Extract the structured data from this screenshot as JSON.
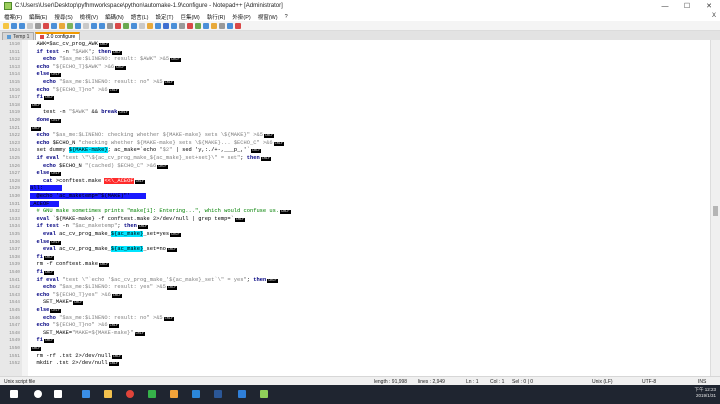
{
  "window": {
    "title": "C:\\Users\\User\\Desktop\\pyfhmworkspace\\python\\automake-1.9\\configure - Notepad++ [Administrator]",
    "controls": {
      "minimize": "—",
      "maximize": "☐",
      "close": "✕"
    }
  },
  "menu": {
    "items": [
      "檔案(F)",
      "編輯(E)",
      "搜尋(S)",
      "檢視(V)",
      "編碼(N)",
      "語言(L)",
      "設定(T)",
      "巨集(M)",
      "執行(R)",
      "外掛(P)",
      "視窗(W)",
      "?"
    ],
    "close": "X"
  },
  "tabs": [
    {
      "label": "Temp 1",
      "active": false
    },
    {
      "label": "2.0 configure",
      "active": true
    }
  ],
  "editor": {
    "lines": [
      {
        "num": "1510",
        "segs": [
          [
            "t",
            "  AWK=$ac_cv_prog_AWK"
          ],
          [
            "eol",
            "CRLF"
          ]
        ]
      },
      {
        "num": "1511",
        "segs": [
          [
            "k",
            "  if test "
          ],
          [
            "t",
            "-n "
          ],
          [
            "s",
            "\"$AWK\""
          ],
          [
            "t",
            "; "
          ],
          [
            "k",
            "then"
          ],
          [
            "eol",
            "CRLF"
          ]
        ]
      },
      {
        "num": "1512",
        "segs": [
          [
            "t",
            "    "
          ],
          [
            "k",
            "echo "
          ],
          [
            "s",
            "\"$as_me:$LINENO: result: $AWK\" >&5"
          ],
          [
            "eol",
            "CRLF"
          ]
        ]
      },
      {
        "num": "1513",
        "segs": [
          [
            "k",
            "  echo "
          ],
          [
            "s",
            "\"${ECHO_T}$AWK\" >&6"
          ],
          [
            "eol",
            "CRLF"
          ]
        ]
      },
      {
        "num": "1514",
        "segs": [
          [
            "k",
            "  else"
          ],
          [
            "eol",
            "CRLF"
          ]
        ]
      },
      {
        "num": "1515",
        "segs": [
          [
            "t",
            "    "
          ],
          [
            "k",
            "echo "
          ],
          [
            "s",
            "\"$as_me:$LINENO: result: no\" >&5"
          ],
          [
            "eol",
            "CRLF"
          ]
        ]
      },
      {
        "num": "1516",
        "segs": [
          [
            "k",
            "  echo "
          ],
          [
            "s",
            "\"${ECHO_T}no\" >&6"
          ],
          [
            "eol",
            "CRLF"
          ]
        ]
      },
      {
        "num": "1517",
        "segs": [
          [
            "k",
            "  fi"
          ],
          [
            "eol",
            "CRLF"
          ]
        ]
      },
      {
        "num": "1518",
        "segs": [
          [
            "eol",
            "CRLF"
          ]
        ]
      },
      {
        "num": "1519",
        "segs": [
          [
            "t",
            "    test -n "
          ],
          [
            "s",
            "\"$AWK\""
          ],
          [
            "t",
            " && "
          ],
          [
            "k",
            "break"
          ],
          [
            "eol",
            "CRLF"
          ]
        ]
      },
      {
        "num": "1520",
        "segs": [
          [
            "k",
            "  done"
          ],
          [
            "eol",
            "CRLF"
          ]
        ]
      },
      {
        "num": "1521",
        "segs": [
          [
            "eol",
            "CRLF"
          ]
        ]
      },
      {
        "num": "1522",
        "segs": [
          [
            "k",
            "  echo "
          ],
          [
            "s",
            "\"$as_me:$LINENO: checking whether ${MAKE-make} sets \\${MAKE}\" >&5"
          ],
          [
            "eol",
            "CRLF"
          ]
        ]
      },
      {
        "num": "1523",
        "segs": [
          [
            "k",
            "  echo "
          ],
          [
            "t",
            "$ECHO_N "
          ],
          [
            "s",
            "\"checking whether ${MAKE-make} sets \\${MAKE}... $ECHO_C\" >&6"
          ],
          [
            "eol",
            "CRLF"
          ]
        ]
      },
      {
        "num": "1524",
        "segs": [
          [
            "t",
            "  set dummy "
          ],
          [
            "cy",
            "${MAKE-make}"
          ],
          [
            "t",
            "; ac_make=`echo "
          ],
          [
            "s",
            "\"$2\""
          ],
          [
            "t",
            " | sed 'y,:./+-,___p_,'`"
          ],
          [
            "eol",
            "CRLF"
          ]
        ]
      },
      {
        "num": "1525",
        "segs": [
          [
            "k",
            "  if eval "
          ],
          [
            "s",
            "\"test \\\"\\${ac_cv_prog_make_${ac_make}_set+set}\\\" = set\""
          ],
          [
            "t",
            "; "
          ],
          [
            "k",
            "then"
          ],
          [
            "eol",
            "CRLF"
          ]
        ]
      },
      {
        "num": "1526",
        "segs": [
          [
            "t",
            "    "
          ],
          [
            "k",
            "echo "
          ],
          [
            "t",
            "$ECHO_N "
          ],
          [
            "s",
            "\"(cached) $ECHO_C\" >&6"
          ],
          [
            "eol",
            "CRLF"
          ]
        ]
      },
      {
        "num": "1527",
        "segs": [
          [
            "k",
            "  else"
          ],
          [
            "eol",
            "CRLF"
          ]
        ]
      },
      {
        "num": "1528",
        "segs": [
          [
            "t",
            "    "
          ],
          [
            "k",
            "cat "
          ],
          [
            "t",
            ">conftest.make "
          ],
          [
            "rd",
            "<<\\_ACEOF"
          ],
          [
            "eol",
            "CRLF"
          ]
        ]
      },
      {
        "num": "1529",
        "segs": [
          [
            "sel",
            "all:      "
          ]
        ]
      },
      {
        "num": "1530",
        "segs": [
          [
            "sel",
            "  @echo 'ac_maketemp=\"$(MAKE)\"'     "
          ]
        ]
      },
      {
        "num": "1531",
        "segs": [
          [
            "sel",
            "_ACEOF   "
          ]
        ]
      },
      {
        "num": "1532",
        "segs": [
          [
            "c",
            "  # GNU make sometimes prints \"make[1]: Entering...\", which would confuse us."
          ],
          [
            "eol",
            "CRLF"
          ]
        ]
      },
      {
        "num": "1533",
        "segs": [
          [
            "k",
            "  eval "
          ],
          [
            "t",
            "`${MAKE-make} -f conftest.make 2>/dev/null | grep temp=`"
          ],
          [
            "eol",
            "CRLF"
          ]
        ]
      },
      {
        "num": "1534",
        "segs": [
          [
            "k",
            "  if test "
          ],
          [
            "t",
            "-n "
          ],
          [
            "s",
            "\"$ac_maketemp\""
          ],
          [
            "t",
            "; "
          ],
          [
            "k",
            "then"
          ],
          [
            "eol",
            "CRLF"
          ]
        ]
      },
      {
        "num": "1535",
        "segs": [
          [
            "t",
            "    "
          ],
          [
            "k",
            "eval "
          ],
          [
            "t",
            "ac_cv_prog_make_"
          ],
          [
            "cy",
            "${ac_make}"
          ],
          [
            "t",
            "_set=yes"
          ],
          [
            "eol",
            "CRLF"
          ]
        ]
      },
      {
        "num": "1536",
        "segs": [
          [
            "k",
            "  else"
          ],
          [
            "eol",
            "CRLF"
          ]
        ]
      },
      {
        "num": "1537",
        "segs": [
          [
            "t",
            "    "
          ],
          [
            "k",
            "eval "
          ],
          [
            "t",
            "ac_cv_prog_make_"
          ],
          [
            "cy",
            "${ac_make}"
          ],
          [
            "t",
            "_set=no"
          ],
          [
            "eol",
            "CRLF"
          ]
        ]
      },
      {
        "num": "1538",
        "segs": [
          [
            "k",
            "  fi"
          ],
          [
            "eol",
            "CRLF"
          ]
        ]
      },
      {
        "num": "1539",
        "segs": [
          [
            "t",
            "  rm -f conftest.make"
          ],
          [
            "eol",
            "CRLF"
          ]
        ]
      },
      {
        "num": "1540",
        "segs": [
          [
            "k",
            "  fi"
          ],
          [
            "eol",
            "CRLF"
          ]
        ]
      },
      {
        "num": "1541",
        "segs": [
          [
            "k",
            "  if eval "
          ],
          [
            "s",
            "\"test \\\"`echo '$ac_cv_prog_make_'${ac_make}_set`\\\" = yes\""
          ],
          [
            "t",
            "; "
          ],
          [
            "k",
            "then"
          ],
          [
            "eol",
            "CRLF"
          ]
        ]
      },
      {
        "num": "1542",
        "segs": [
          [
            "t",
            "    "
          ],
          [
            "k",
            "echo "
          ],
          [
            "s",
            "\"$as_me:$LINENO: result: yes\" >&5"
          ],
          [
            "eol",
            "CRLF"
          ]
        ]
      },
      {
        "num": "1543",
        "segs": [
          [
            "k",
            "  echo "
          ],
          [
            "s",
            "\"${ECHO_T}yes\" >&6"
          ],
          [
            "eol",
            "CRLF"
          ]
        ]
      },
      {
        "num": "1544",
        "segs": [
          [
            "t",
            "    SET_MAKE="
          ],
          [
            "eol",
            "CRLF"
          ]
        ]
      },
      {
        "num": "1545",
        "segs": [
          [
            "k",
            "  else"
          ],
          [
            "eol",
            "CRLF"
          ]
        ]
      },
      {
        "num": "1546",
        "segs": [
          [
            "t",
            "    "
          ],
          [
            "k",
            "echo "
          ],
          [
            "s",
            "\"$as_me:$LINENO: result: no\" >&5"
          ],
          [
            "eol",
            "CRLF"
          ]
        ]
      },
      {
        "num": "1547",
        "segs": [
          [
            "k",
            "  echo "
          ],
          [
            "s",
            "\"${ECHO_T}no\" >&6"
          ],
          [
            "eol",
            "CRLF"
          ]
        ]
      },
      {
        "num": "1548",
        "segs": [
          [
            "t",
            "    SET_MAKE="
          ],
          [
            "s",
            "\"MAKE=${MAKE-make}\""
          ],
          [
            "eol",
            "CRLF"
          ]
        ]
      },
      {
        "num": "1549",
        "segs": [
          [
            "k",
            "  fi"
          ],
          [
            "eol",
            "CRLF"
          ]
        ]
      },
      {
        "num": "1550",
        "segs": [
          [
            "eol",
            "CRLF"
          ]
        ]
      },
      {
        "num": "1551",
        "segs": [
          [
            "t",
            "  rm -rf .tst 2>/dev/null"
          ],
          [
            "eol",
            "CRLF"
          ]
        ]
      },
      {
        "num": "1552",
        "segs": [
          [
            "t",
            "  mkdir .tst 2>/dev/null"
          ],
          [
            "eol",
            "CRLF"
          ]
        ]
      }
    ]
  },
  "status": {
    "file_type": "Unix script file",
    "length": "length : 91,998",
    "lines": "lines : 2,949",
    "ln": "Ln : 1",
    "col": "Col : 1",
    "sel": "Sel : 0 | 0",
    "eol": "Unix (LF)",
    "encoding": "UTF-8",
    "mode": "INS"
  },
  "taskbar": {
    "time": "下午 12:23",
    "date": "2019/1/31"
  },
  "colors": {
    "keyword": "#000080",
    "string": "#808080",
    "comment": "#008000",
    "highlight_cyan": "#00e5ff",
    "highlight_red": "#ff2a2a",
    "selection": "#1a1aff",
    "active_tab_accent": "#f29a00"
  }
}
